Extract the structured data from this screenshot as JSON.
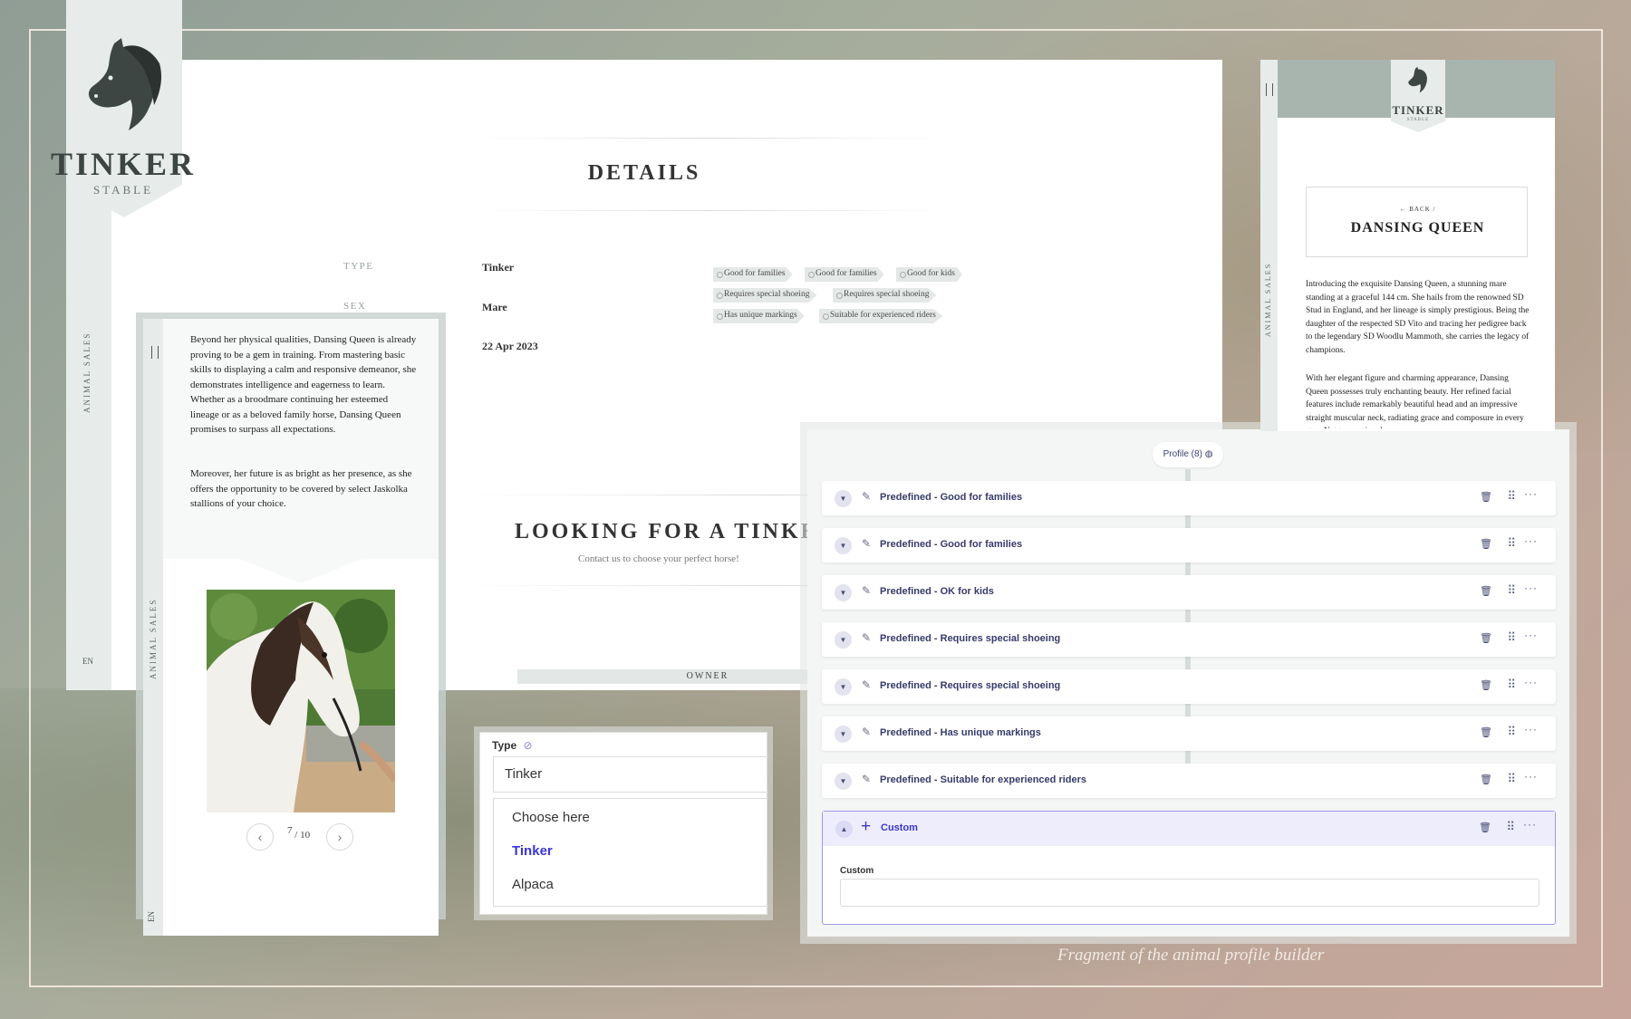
{
  "logo": {
    "word": "TINKER",
    "sub": "STABLE"
  },
  "side_labels": {
    "animal_sales": "ANIMAL SALES",
    "lang": "EN"
  },
  "details": {
    "title": "DETAILS",
    "fields": [
      {
        "label": "TYPE",
        "value": "Tinker"
      },
      {
        "label": "SEX",
        "value": "Mare"
      },
      {
        "label": "",
        "value": "22 Apr 2023"
      }
    ],
    "tags": [
      "Good for families",
      "Good for families",
      "Good for kids",
      "Requires special shoeing",
      "Requires special shoeing",
      "Has unique markings",
      "Suitable for experienced riders"
    ],
    "looking_title": "LOOKING FOR A TINKER?",
    "looking_sub": "Contact us to choose your perfect horse!",
    "owner": "OWNER"
  },
  "mobile": {
    "paragraphs": [
      "Beyond her physical qualities, Dansing Queen is already proving to be a gem in training. From mastering basic skills to displaying a calm and responsive demeanor, she demonstrates intelligence and eagerness to learn. Whether as a broodmare continuing her esteemed lineage or as a beloved family horse, Dansing Queen promises to surpass all expectations.",
      "Moreover, her future is as bright as her presence, as she offers the opportunity to be covered by select Jaskolka stallions of your choice."
    ],
    "pager": {
      "current": "7",
      "total": "10"
    },
    "prev_icon": "chevron-left-icon",
    "next_icon": "chevron-right-icon"
  },
  "type_select": {
    "label": "Type",
    "value": "Tinker",
    "options": [
      "Choose here",
      "Tinker",
      "Alpaca"
    ],
    "selected_index": 1,
    "accent": "#3a35d8"
  },
  "builder": {
    "profile_label": "Profile (8)",
    "rows": [
      "Predefined - Good for families",
      "Predefined - Good for families",
      "Predefined - OK for kids",
      "Predefined - Requires special shoeing",
      "Predefined - Requires special shoeing",
      "Predefined - Has unique markings",
      "Predefined - Suitable for experienced riders"
    ],
    "custom": {
      "title": "Custom",
      "field_label": "Custom",
      "value": ""
    },
    "accent": "#3a36c9"
  },
  "preview": {
    "logo_word": "TINKER",
    "logo_sub": "STABLE",
    "back": "← BACK /",
    "name": "DANSING QUEEN",
    "paragraphs": [
      "Introducing the exquisite Dansing Queen, a stunning mare standing at a graceful 144 cm. She hails from the renowned SD Stud in England, and her lineage is simply prestigious. Being the daughter of the respected SD Vito and tracing her pedigree back to the legendary SD Woodlu Mammoth, she carries the legacy of champions.",
      "With her elegant figure and charming appearance, Dansing Queen possesses truly enchanting beauty. Her refined facial features include remarkably beautiful head and an impressive straight muscular neck, radiating grace and composure in every step. Not to mention, her"
    ]
  },
  "caption": "Fragment of the animal profile builder"
}
